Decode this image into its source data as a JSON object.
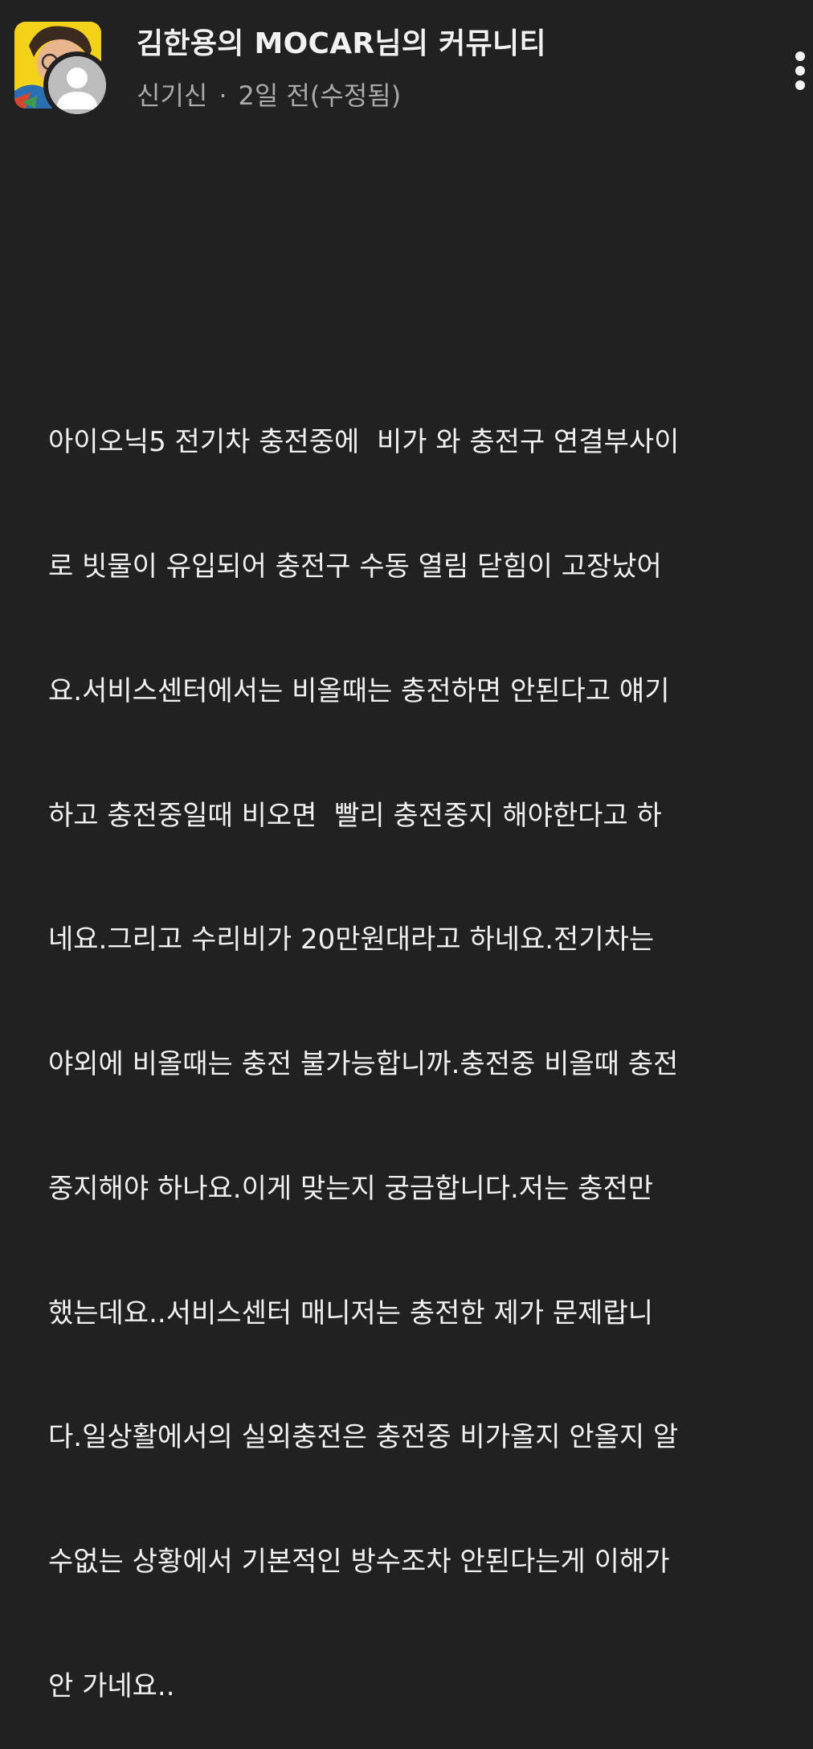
{
  "post": {
    "community_title": "김한용의 MOCAR님의 커뮤니티",
    "author": "신기신",
    "separator": "·",
    "timestamp": "2일 전(수정됨)",
    "body_lines": [
      "아이오닉5 전기차 충전중에  비가 와 충전구 연결부사이",
      "로 빗물이 유입되어 충전구 수동 열림 닫힘이 고장났어",
      "요.서비스센터에서는 비올때는 충전하면 안된다고 얘기",
      "하고 충전중일때 비오면  빨리 충전중지 해야한다고 하",
      "네요.그리고 수리비가 20만원대라고 하네요.전기차는",
      "야외에 비올때는 충전 불가능합니까.충전중 비올때 충전",
      "중지해야 하나요.이게 맞는지 궁금합니다.저는 충전만",
      "했는데요..서비스센터 매니저는 충전한 제가 문제랍니",
      "다.일상활에서의 실외충전은 충전중 비가올지 안올지 알",
      "수없는 상황에서 기본적인 방수조차 안된다는게 이해가",
      "안 가네요.."
    ]
  },
  "icons": {
    "more": "more-vert-icon",
    "channel_avatar": "channel-avatar-icon",
    "user_avatar": "default-user-icon"
  },
  "colors": {
    "background": "#212121",
    "text_primary": "#f1f1f1",
    "text_secondary": "#aaaaaa",
    "channel_avatar_bg": "#f5d21a"
  }
}
